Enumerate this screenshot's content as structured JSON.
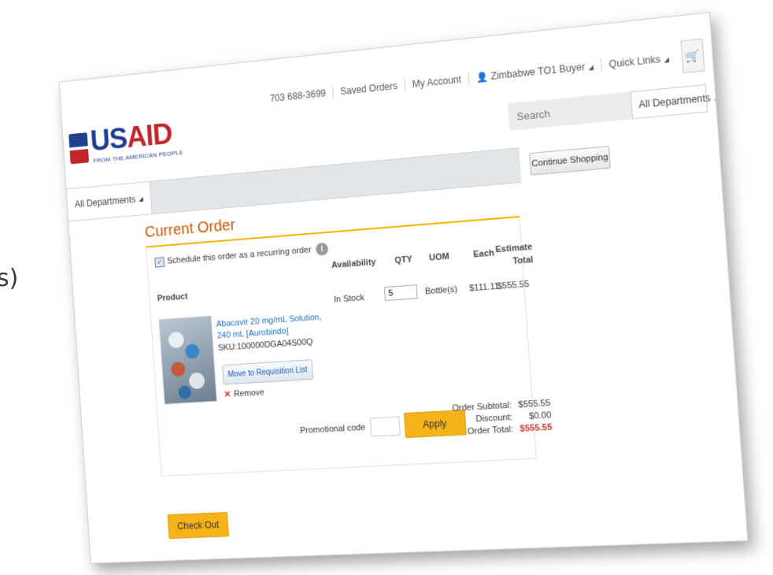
{
  "slide_fragment": "s)",
  "brand": {
    "logo_word_1": "US",
    "logo_word_2": "AID",
    "tagline": "FROM THE AMERICAN PEOPLE"
  },
  "topnav": {
    "phone": "703 688-3699",
    "saved_orders": "Saved Orders",
    "my_account": "My Account",
    "user": "Zimbabwe TO1 Buyer",
    "quick_links": "Quick Links"
  },
  "search": {
    "placeholder": "Search",
    "department": "All Departments"
  },
  "navbar": {
    "departments": "All Departments"
  },
  "continue_shopping": "Continue Shopping",
  "order": {
    "title": "Current Order",
    "recurring_label": "Schedule this order as a recurring order",
    "recurring_checked": true,
    "columns": {
      "product": "Product",
      "availability": "Availability",
      "qty": "QTY",
      "uom": "UOM",
      "each": "Each",
      "estimate": "Estimate",
      "total": "Total"
    },
    "item": {
      "name": "Abacavir 20 mg/mL Solution, 240 mL [Aurobindo]",
      "sku": "SKU:100000DGA04S00Q",
      "availability": "In Stock",
      "qty": "5",
      "uom": "Bottle(s)",
      "each": "$111.11",
      "estimate_total": "$555.55",
      "move_label": "Move to Requisition List",
      "remove_label": "Remove"
    },
    "promo_label": "Promotional code",
    "apply_label": "Apply",
    "summary": {
      "subtotal_label": "Order Subtotal:",
      "subtotal": "$555.55",
      "discount_label": "Discount:",
      "discount": "$0.00",
      "total_label": "Order Total:",
      "total": "$555.55"
    },
    "checkout_label": "Check Out"
  },
  "colors": {
    "accent_orange": "#d35400",
    "button_yellow": "#f6b21b",
    "link_blue": "#1a6fc4",
    "total_red": "#c0392b"
  }
}
